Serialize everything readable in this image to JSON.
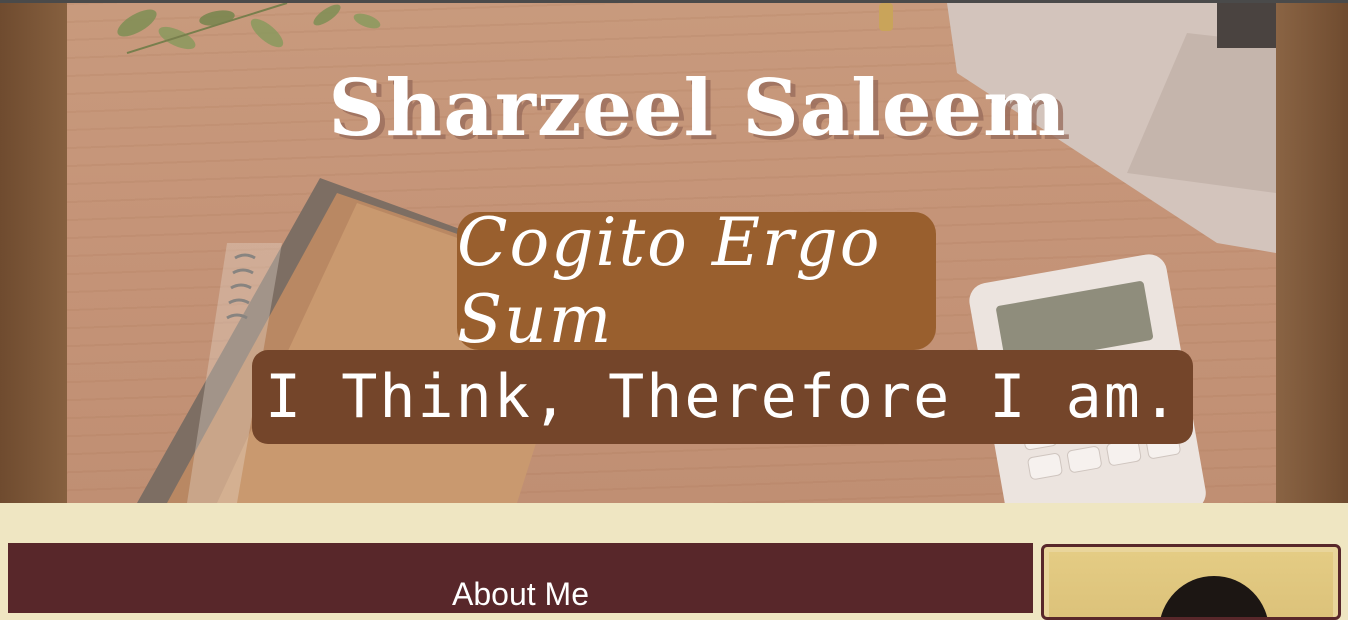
{
  "hero": {
    "title": "Sharzeel Saleem",
    "latin_motto": "Cogito Ergo Sum",
    "english_motto": "I Think, Therefore I am."
  },
  "about": {
    "heading": "About Me"
  },
  "colors": {
    "page_background": "#efe6c2",
    "latin_badge": "#995f2e",
    "english_badge": "#74452a",
    "about_card": "#58272a"
  }
}
